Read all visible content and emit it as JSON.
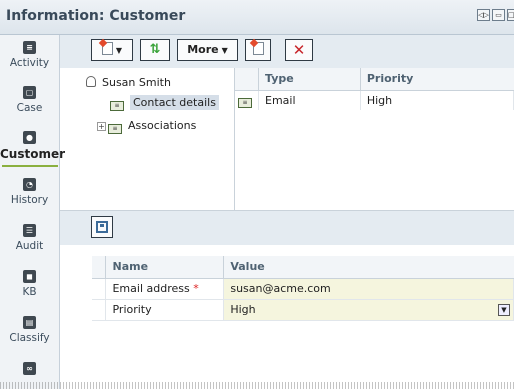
{
  "window": {
    "title": "Information: Customer",
    "controls": [
      "restore-icon",
      "maximize-icon",
      "close-icon"
    ]
  },
  "left_nav": {
    "items": [
      {
        "label": "Activity",
        "icon": "activity-icon",
        "active": false
      },
      {
        "label": "Case",
        "icon": "case-icon",
        "active": false
      },
      {
        "label": "Customer",
        "icon": "customer-icon",
        "active": true
      },
      {
        "label": "History",
        "icon": "history-icon",
        "active": false
      },
      {
        "label": "Audit",
        "icon": "audit-icon",
        "active": false
      },
      {
        "label": "KB",
        "icon": "kb-icon",
        "active": false
      },
      {
        "label": "Classify",
        "icon": "classify-icon",
        "active": false
      },
      {
        "label": "",
        "icon": "link-icon",
        "active": false
      }
    ]
  },
  "toolbar": {
    "more_label": "More"
  },
  "tree": {
    "root": "Susan Smith",
    "child_selected": "Contact details",
    "child_2": "Associations"
  },
  "contact_grid": {
    "headers": [
      "Type",
      "Priority"
    ],
    "rows": [
      {
        "type": "Email",
        "priority": "High"
      }
    ]
  },
  "properties": {
    "headers": [
      "Name",
      "Value"
    ],
    "rows": [
      {
        "name": "Email address",
        "required": "*",
        "value": "susan@acme.com"
      },
      {
        "name": "Priority",
        "required": "",
        "value": "High"
      }
    ]
  },
  "colors": {
    "active_underline": "#8bb03f",
    "required": "#dd2222",
    "edit_cell": "#f5f5de"
  }
}
